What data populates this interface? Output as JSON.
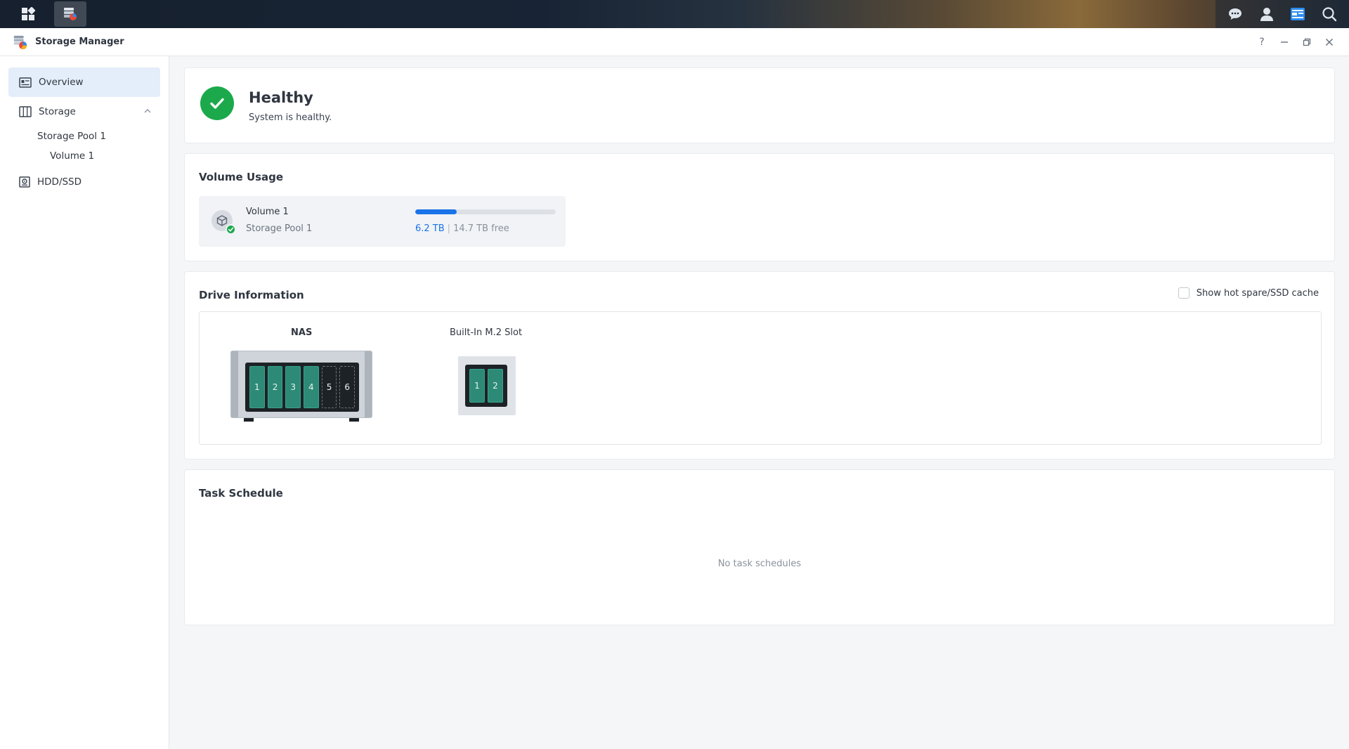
{
  "window": {
    "title": "Storage Manager",
    "controls": [
      "?",
      "–",
      "▫",
      "×"
    ]
  },
  "sidebar": {
    "items": [
      {
        "label": "Overview",
        "icon": "overview-icon"
      },
      {
        "label": "Storage",
        "icon": "storage-icon"
      },
      {
        "label": "Storage Pool 1"
      },
      {
        "label": "Volume 1"
      },
      {
        "label": "HDD/SSD",
        "icon": "hdd-icon"
      }
    ]
  },
  "health": {
    "status": "Healthy",
    "description": "System is healthy."
  },
  "volume_usage": {
    "title": "Volume Usage",
    "volume_name": "Volume 1",
    "pool_name": "Storage Pool 1",
    "used": "6.2 TB",
    "separator": "|",
    "free": "14.7 TB free",
    "used_fraction": 0.297
  },
  "drive_info": {
    "title": "Drive Information",
    "hotspare_label": "Show hot spare/SSD cache",
    "nas_label": "NAS",
    "nas_bays": [
      {
        "num": "1",
        "filled": true
      },
      {
        "num": "2",
        "filled": true
      },
      {
        "num": "3",
        "filled": true
      },
      {
        "num": "4",
        "filled": true
      },
      {
        "num": "5",
        "filled": false
      },
      {
        "num": "6",
        "filled": false
      }
    ],
    "m2_label": "Built-In M.2 Slot",
    "m2_slots": [
      "1",
      "2"
    ]
  },
  "task_schedule": {
    "title": "Task Schedule",
    "empty_message": "No task schedules"
  },
  "colors": {
    "accent": "#1a73e8",
    "healthy": "#1ba94c",
    "drive": "#2c8a76"
  }
}
